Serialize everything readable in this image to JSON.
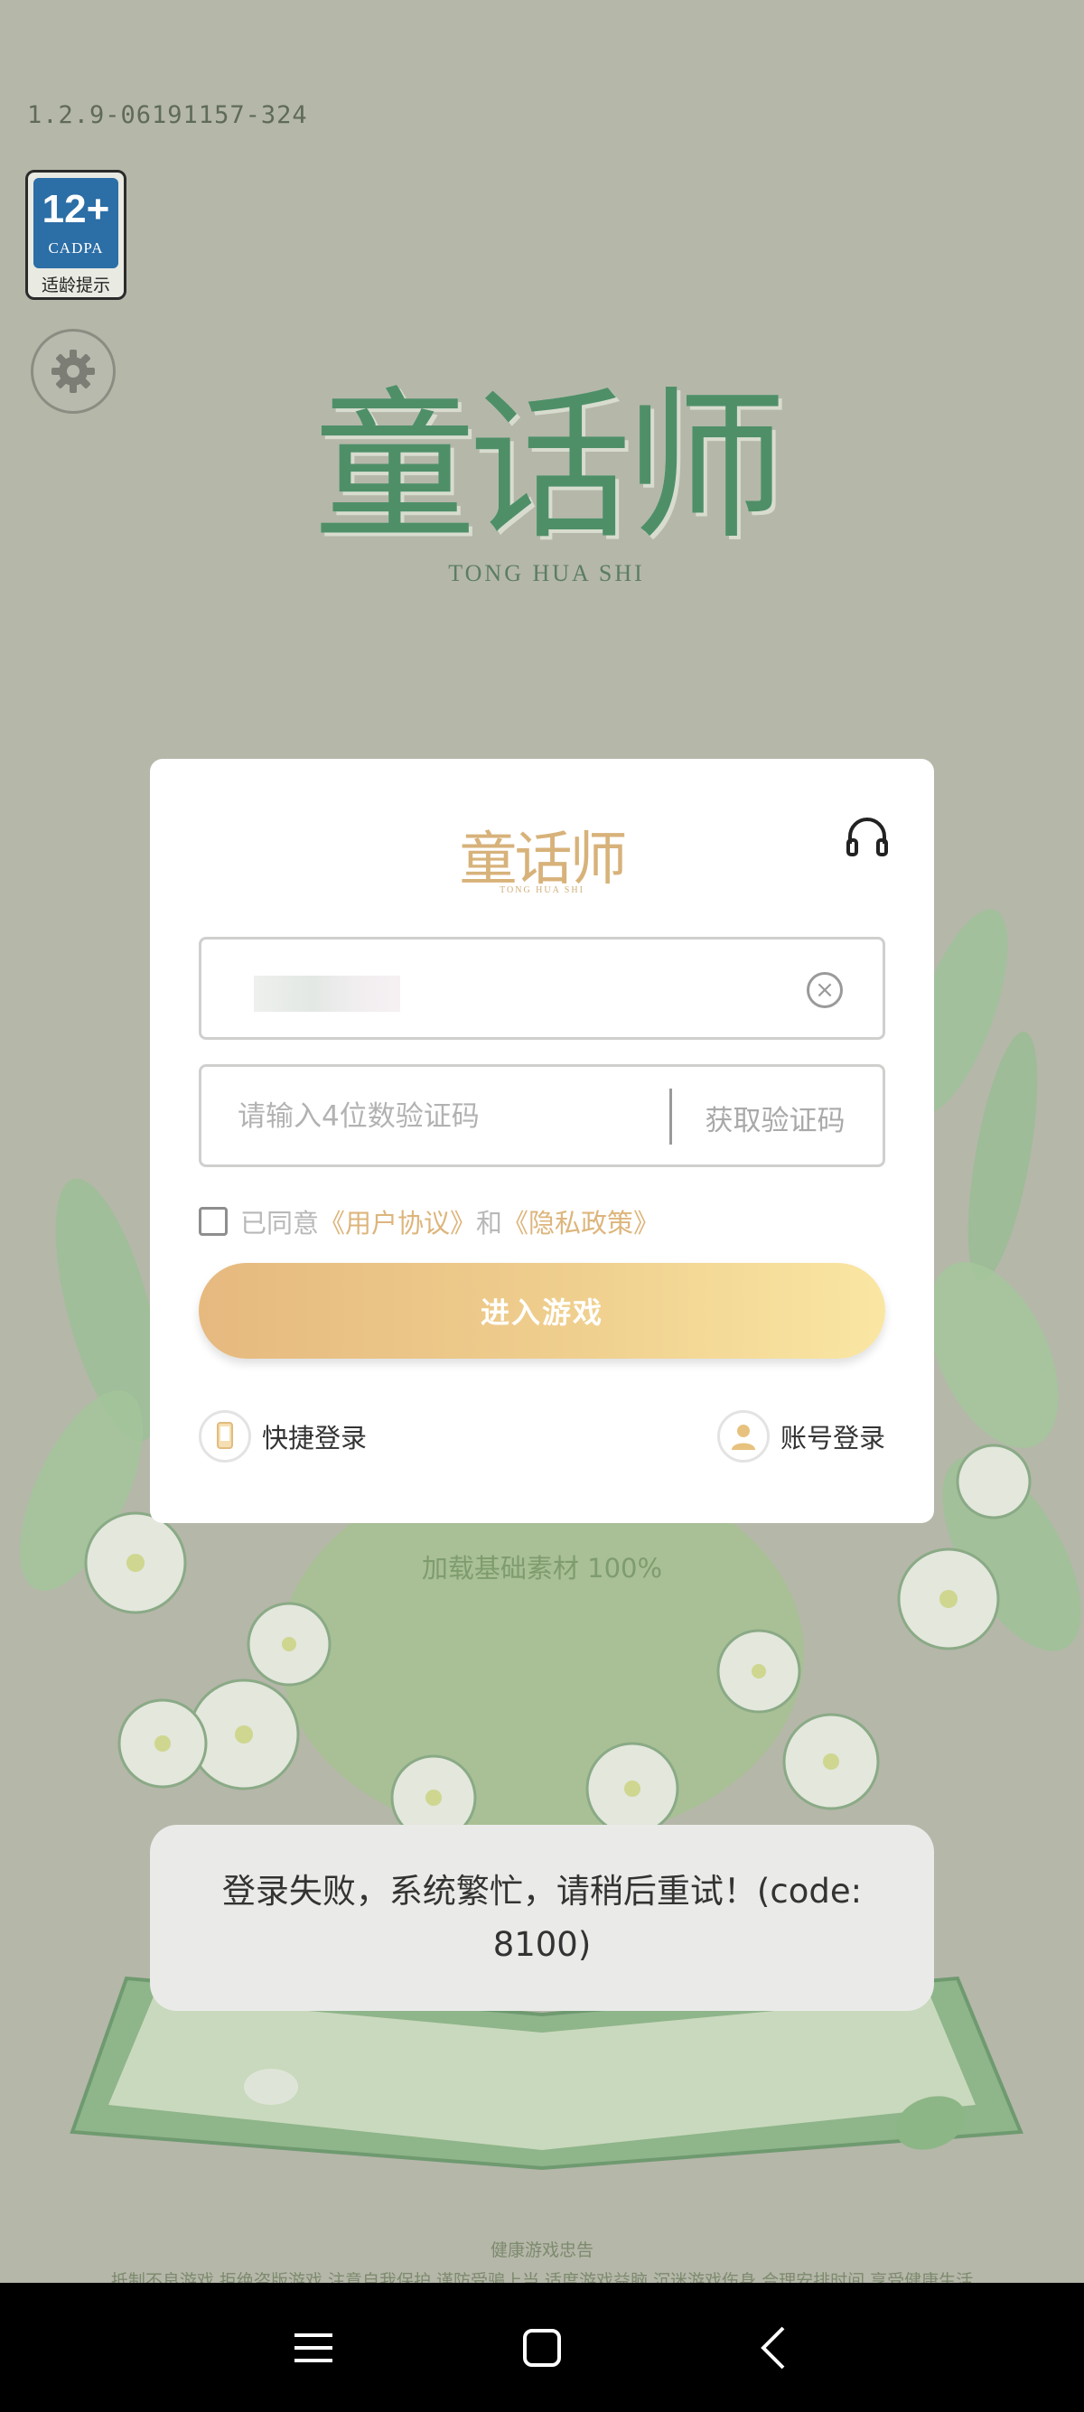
{
  "app": {
    "version": "1.2.9-06191157-324",
    "age_rating": {
      "number": "12+",
      "org": "CADPA",
      "tip": "适龄提示"
    },
    "logo": {
      "title": "童话师",
      "subtitle": "TONG HUA SHI"
    },
    "loading_text": "加载基础素材 100%",
    "health_notice": {
      "title": "健康游戏忠告",
      "line": "抵制不良游戏 拒绝盗版游戏 注意自我保护 谨防受骗上当 适度游戏益脑 沉迷游戏伤身 合理安排时间 享受健康生活"
    }
  },
  "login_dialog": {
    "logo_title": "童话师",
    "logo_subtitle": "TONG HUA SHI",
    "phone_value": "",
    "code_placeholder": "请输入4位数验证码",
    "get_code_label": "获取验证码",
    "agree": {
      "prefix": "已同意",
      "user_agreement": "《用户协议》",
      "and": "和",
      "privacy_policy": "《隐私政策》",
      "checked": false
    },
    "enter_button": "进入游戏",
    "quick_login": "快捷登录",
    "account_login": "账号登录"
  },
  "toast": {
    "message": "登录失败，系统繁忙，请稍后重试！(code: 8100)"
  },
  "colors": {
    "accent_gold": "#ddb57c",
    "backdrop": "#b5b7a9",
    "logo_green": "#4f8f68"
  },
  "icons": [
    "settings-icon",
    "headset-icon",
    "clear-icon",
    "phone-icon",
    "user-icon",
    "menu-icon",
    "home-icon",
    "back-icon"
  ]
}
